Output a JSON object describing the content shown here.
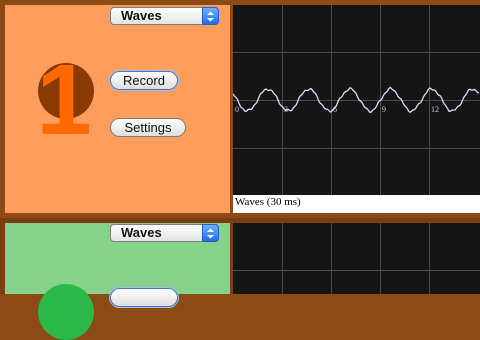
{
  "channels": [
    {
      "number": "1",
      "theme": {
        "panel": "#ff9d5d",
        "frame": "#8b4a16",
        "badge": "#8a3a00",
        "digit": "#ff6a00"
      },
      "waveform_select": {
        "selected": "Waves"
      },
      "record_label": "Record",
      "settings_label": "Settings",
      "scope": {
        "caption": "Waves (30 ms)",
        "x_ticks": [
          "0",
          "3",
          "6",
          "9",
          "12"
        ],
        "trace_color": "#dcdcff",
        "gridlines": "on"
      }
    },
    {
      "theme": {
        "panel": "#87d28b",
        "frame": "#7a3e12",
        "badge": "#2cb84a"
      },
      "waveform_select": {
        "selected": "Waves"
      },
      "scope": {
        "gridlines": "on"
      }
    }
  ],
  "icons": {
    "popup_arrows": "updown-chevron-icon"
  }
}
